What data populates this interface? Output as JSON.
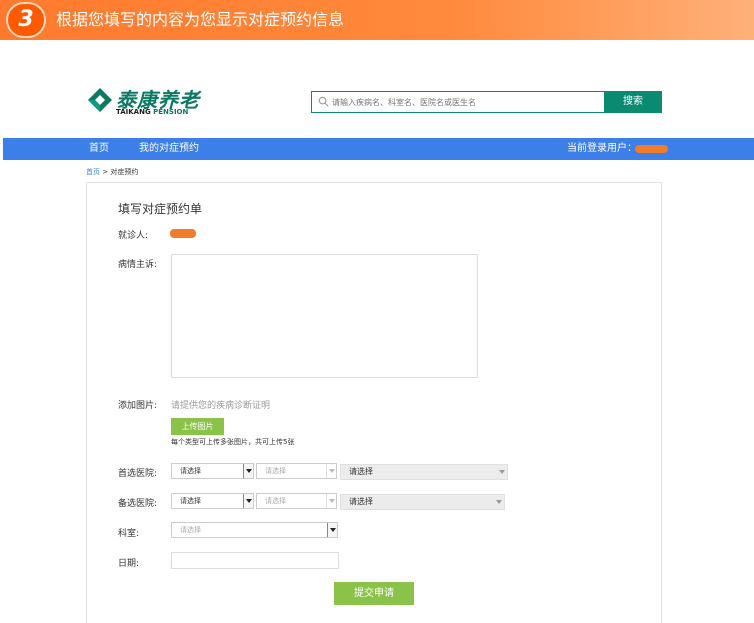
{
  "banner": {
    "step": "3",
    "text": "根据您填写的内容为您显示对症预约信息"
  },
  "header": {
    "logo_cn": "泰康养老",
    "logo_en_a": "TAIKANG",
    "logo_en_b": " PENSION",
    "search_placeholder": "请输入疾病名、科室名、医院名或医生名",
    "search_button": "搜索"
  },
  "nav": {
    "items": [
      {
        "label": "首页"
      },
      {
        "label": "我的对症预约"
      }
    ],
    "user_label": "当前登录用户："
  },
  "breadcrumb": {
    "home": "首页",
    "sep": " > ",
    "current": "对症预约"
  },
  "form": {
    "title": "填写对症预约单",
    "patient_label": "就诊人:",
    "complaint_label": "病情主诉:",
    "image_label": "添加图片:",
    "image_hint": "请提供您的疾病诊断证明",
    "upload_button": "上传图片",
    "upload_note": "每个类型可上传多张图片，共可上传5张",
    "first_hospital_label": "首选医院:",
    "second_hospital_label": "备选医院:",
    "department_label": "科室:",
    "date_label": "日期:",
    "select_placeholder": "请选择",
    "submit_button": "提交申请"
  },
  "colors": {
    "banner": "#ff7a2e",
    "brand_green": "#0a8a70",
    "nav_blue": "#3d7fe8",
    "button_green": "#8bc34a",
    "redaction": "#f07c2c"
  }
}
